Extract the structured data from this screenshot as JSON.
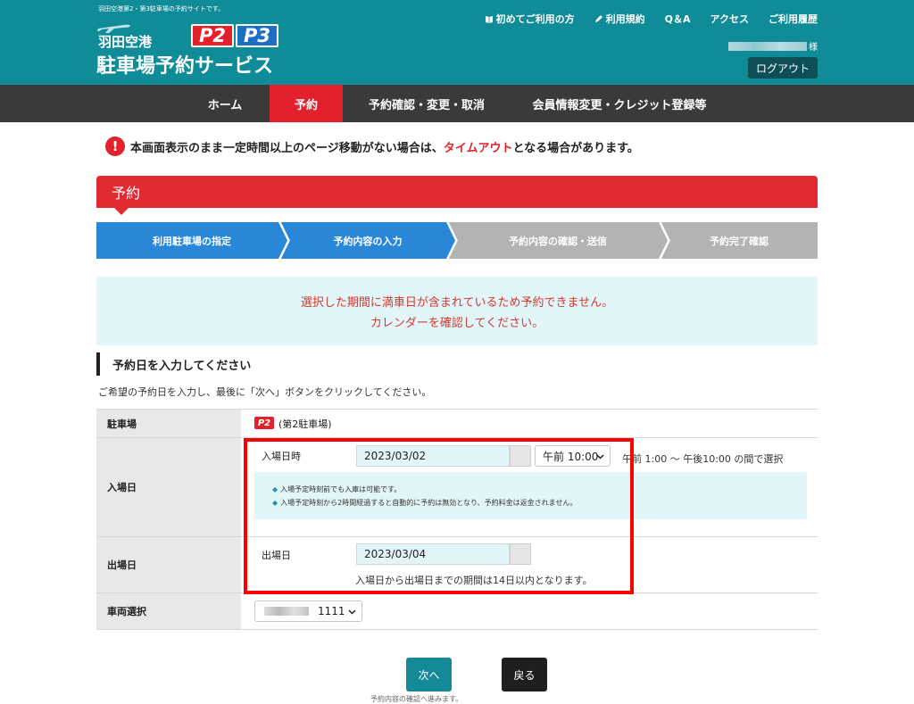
{
  "header": {
    "tagline": "羽田空港第2・第3駐車場の予約サイトです。",
    "logo_sub": "羽田空港",
    "logo_main": "駐車場予約サービス",
    "badge_p2": "P2",
    "badge_p3": "P3",
    "topnav": [
      {
        "label": "初めてご利用の方",
        "icon": "book-icon"
      },
      {
        "label": "利用規約",
        "icon": "pencil-icon"
      },
      {
        "label": "Q＆A"
      },
      {
        "label": "アクセス"
      },
      {
        "label": "ご利用履歴"
      }
    ],
    "user_suffix": "様",
    "logout": "ログアウト"
  },
  "mainnav": {
    "tabs": [
      "ホーム",
      "予約",
      "予約確認・変更・取消",
      "会員情報変更・クレジット登録等"
    ],
    "active": "予約"
  },
  "warning": {
    "pre": "本画面表示のまま一定時間以上のページ移動がない場合は、",
    "highlight": "タイムアウト",
    "post": "となる場合があります。"
  },
  "section_title": "予約",
  "steps": [
    {
      "label": "利用駐車場の指定",
      "state": "done"
    },
    {
      "label": "予約内容の入力",
      "state": "current"
    },
    {
      "label": "予約内容の確認・送信",
      "state": "pending"
    },
    {
      "label": "予約完了確認",
      "state": "pending"
    }
  ],
  "alert": {
    "line1": "選択した期間に満車日が含まれているため予約できません。",
    "line2": "カレンダーを確認してください。"
  },
  "form": {
    "heading": "予約日を入力してください",
    "instruction": "ご希望の予約日を入力し、最後に「次へ」ボタンをクリックしてください。",
    "parking_label": "駐車場",
    "parking_badge": "P2",
    "parking_value": "(第2駐車場)",
    "entry_label": "入場日",
    "entry_datetime_label": "入場日時",
    "entry_date": "2023/03/02",
    "entry_time": "午前 10:00",
    "entry_time_hint": "午前 1:00 ～ 午後10:00 の間で選択",
    "notes": [
      "入場予定時刻前でも入庫は可能です。",
      "入場予定時刻から2時間経過すると自動的に予約は無効となり、予約料金は返金されません。"
    ],
    "exit_label": "出場日",
    "exit_date_label": "出場日",
    "exit_date": "2023/03/04",
    "exit_hint": "入場日から出場日までの期間は14日以内となります。",
    "vehicle_label": "車両選択",
    "vehicle_value": "1111"
  },
  "buttons": {
    "next": "次へ",
    "back": "戻る"
  },
  "footnote": "予約内容の確認へ進みます。",
  "colors": {
    "teal": "#0f8c98",
    "red": "#e2212c",
    "blue": "#1d6fc4",
    "step_blue": "#2a87d8",
    "step_grey": "#b3b3b3"
  }
}
